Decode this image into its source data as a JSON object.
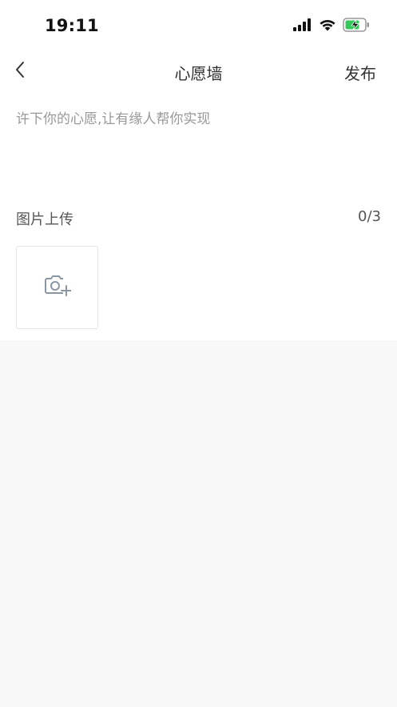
{
  "status_bar": {
    "time": "19:11"
  },
  "nav": {
    "title": "心愿墙",
    "publish_label": "发布"
  },
  "wish": {
    "placeholder": "许下你的心愿,让有缘人帮你实现",
    "value": ""
  },
  "upload": {
    "label": "图片上传",
    "count": "0/3"
  },
  "colors": {
    "accent_battery": "#34c759",
    "icon_gray": "#8a96a3",
    "background": "#f8f8f8"
  }
}
